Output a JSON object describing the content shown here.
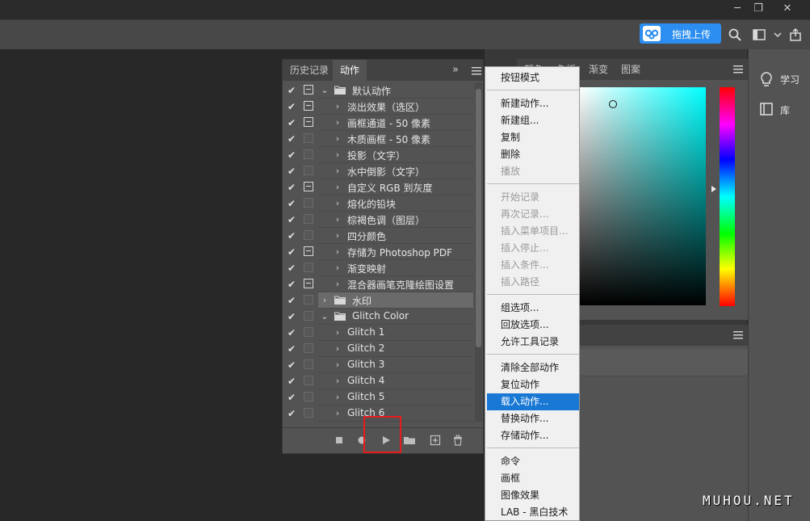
{
  "window_controls": {
    "minimize": "─",
    "restore": "❐",
    "close": "✕"
  },
  "options_bar": {
    "upload_button": "拖拽上传",
    "colors": {
      "upload_bg": "#2b8ef0"
    }
  },
  "actions_panel": {
    "tabs": [
      "历史记录",
      "动作"
    ],
    "active_tab": "动作",
    "expand_glyph": "»",
    "rows": [
      {
        "checked": true,
        "dialog": "on",
        "level": 0,
        "type": "set",
        "open": true,
        "label": "默认动作"
      },
      {
        "checked": true,
        "dialog": "on",
        "level": 1,
        "type": "action",
        "open": false,
        "label": "淡出效果（选区）"
      },
      {
        "checked": true,
        "dialog": "on",
        "level": 1,
        "type": "action",
        "open": false,
        "label": "画框通道 - 50 像素"
      },
      {
        "checked": true,
        "dialog": "off",
        "level": 1,
        "type": "action",
        "open": false,
        "label": "木质画框 - 50 像素"
      },
      {
        "checked": true,
        "dialog": "off",
        "level": 1,
        "type": "action",
        "open": false,
        "label": "投影（文字）"
      },
      {
        "checked": true,
        "dialog": "off",
        "level": 1,
        "type": "action",
        "open": false,
        "label": "水中倒影（文字）"
      },
      {
        "checked": true,
        "dialog": "on",
        "level": 1,
        "type": "action",
        "open": false,
        "label": "自定义 RGB 到灰度"
      },
      {
        "checked": true,
        "dialog": "off",
        "level": 1,
        "type": "action",
        "open": false,
        "label": "熔化的铅块"
      },
      {
        "checked": true,
        "dialog": "off",
        "level": 1,
        "type": "action",
        "open": false,
        "label": "棕褐色调（图层）"
      },
      {
        "checked": true,
        "dialog": "off",
        "level": 1,
        "type": "action",
        "open": false,
        "label": "四分颜色"
      },
      {
        "checked": true,
        "dialog": "on",
        "level": 1,
        "type": "action",
        "open": false,
        "label": "存储为 Photoshop PDF"
      },
      {
        "checked": true,
        "dialog": "off",
        "level": 1,
        "type": "action",
        "open": false,
        "label": "渐变映射"
      },
      {
        "checked": true,
        "dialog": "on",
        "level": 1,
        "type": "action",
        "open": false,
        "label": "混合器画笔克隆绘图设置"
      },
      {
        "checked": true,
        "dialog": "off",
        "level": 0,
        "type": "set",
        "open": false,
        "label": "水印",
        "selected": true
      },
      {
        "checked": true,
        "dialog": "off",
        "level": 0,
        "type": "set",
        "open": true,
        "label": "Glitch Color"
      },
      {
        "checked": true,
        "dialog": "off",
        "level": 1,
        "type": "action",
        "open": false,
        "label": "Glitch 1"
      },
      {
        "checked": true,
        "dialog": "off",
        "level": 1,
        "type": "action",
        "open": false,
        "label": "Glitch 2"
      },
      {
        "checked": true,
        "dialog": "off",
        "level": 1,
        "type": "action",
        "open": false,
        "label": "Glitch 3"
      },
      {
        "checked": true,
        "dialog": "off",
        "level": 1,
        "type": "action",
        "open": false,
        "label": "Glitch 4"
      },
      {
        "checked": true,
        "dialog": "off",
        "level": 1,
        "type": "action",
        "open": false,
        "label": "Glitch 5"
      },
      {
        "checked": true,
        "dialog": "off",
        "level": 1,
        "type": "action",
        "open": false,
        "label": "Glitch 6"
      }
    ],
    "footer_icons": [
      "stop-icon",
      "record-icon",
      "play-icon",
      "new-set-icon",
      "new-action-icon",
      "delete-icon"
    ]
  },
  "color_panel": {
    "tabs": [
      "颜色",
      "色板",
      "渐变",
      "图案"
    ],
    "hue_base": "#00ffff"
  },
  "menu": {
    "groups": [
      [
        {
          "label": "按钮模式",
          "enabled": true
        }
      ],
      [
        {
          "label": "新建动作...",
          "enabled": true
        },
        {
          "label": "新建组...",
          "enabled": true
        },
        {
          "label": "复制",
          "enabled": true
        },
        {
          "label": "删除",
          "enabled": true
        },
        {
          "label": "播放",
          "enabled": false
        }
      ],
      [
        {
          "label": "开始记录",
          "enabled": false
        },
        {
          "label": "再次记录...",
          "enabled": false
        },
        {
          "label": "插入菜单项目...",
          "enabled": false
        },
        {
          "label": "插入停止...",
          "enabled": false
        },
        {
          "label": "插入条件...",
          "enabled": false
        },
        {
          "label": "插入路径",
          "enabled": false
        }
      ],
      [
        {
          "label": "组选项...",
          "enabled": true
        },
        {
          "label": "回放选项...",
          "enabled": true
        },
        {
          "label": "允许工具记录",
          "enabled": true
        }
      ],
      [
        {
          "label": "清除全部动作",
          "enabled": true
        },
        {
          "label": "复位动作",
          "enabled": true
        },
        {
          "label": "载入动作...",
          "enabled": true,
          "highlighted": true
        },
        {
          "label": "替换动作...",
          "enabled": true
        },
        {
          "label": "存储动作...",
          "enabled": true
        }
      ],
      [
        {
          "label": "命令",
          "enabled": true
        },
        {
          "label": "画框",
          "enabled": true
        },
        {
          "label": "图像效果",
          "enabled": true
        },
        {
          "label": "LAB - 黑白技术",
          "enabled": true
        }
      ]
    ],
    "colors": {
      "highlight": "#1978d4"
    }
  },
  "dock": {
    "items": [
      {
        "icon": "lightbulb-icon",
        "label": "学习"
      },
      {
        "icon": "library-icon",
        "label": "库"
      }
    ]
  },
  "watermark": "MUHOU.NET"
}
